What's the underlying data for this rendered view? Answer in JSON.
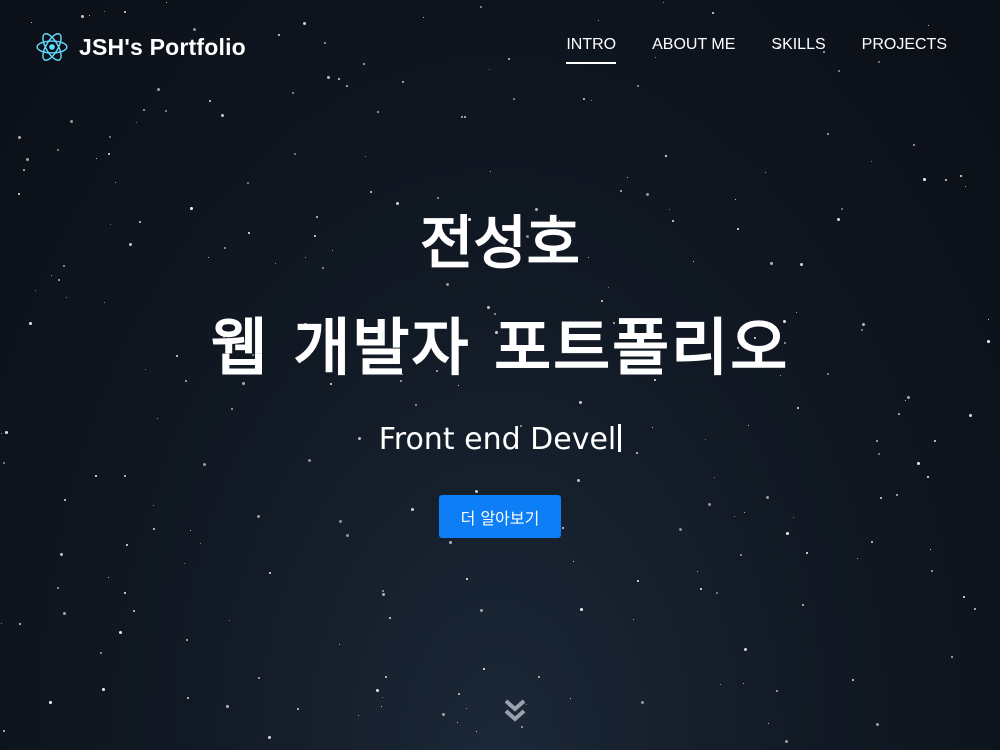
{
  "brand": {
    "title": "JSH's Portfolio",
    "icon": "react-atom-icon",
    "icon_color": "#61dafb"
  },
  "nav": {
    "items": [
      {
        "label": "INTRO",
        "active": true
      },
      {
        "label": "ABOUT ME",
        "active": false
      },
      {
        "label": "SKILLS",
        "active": false
      },
      {
        "label": "PROJECTS",
        "active": false
      }
    ]
  },
  "hero": {
    "name": "전성호",
    "subtitle": "웹 개발자 포트폴리오",
    "typed_text": "Front end Devel",
    "button_label": "더 알아보기",
    "scroll_icon": "double-chevron-down-icon"
  },
  "colors": {
    "accent": "#0d7ef5",
    "background": "#111924",
    "text": "#ffffff",
    "scroll_icon": "#9aa3ad"
  }
}
